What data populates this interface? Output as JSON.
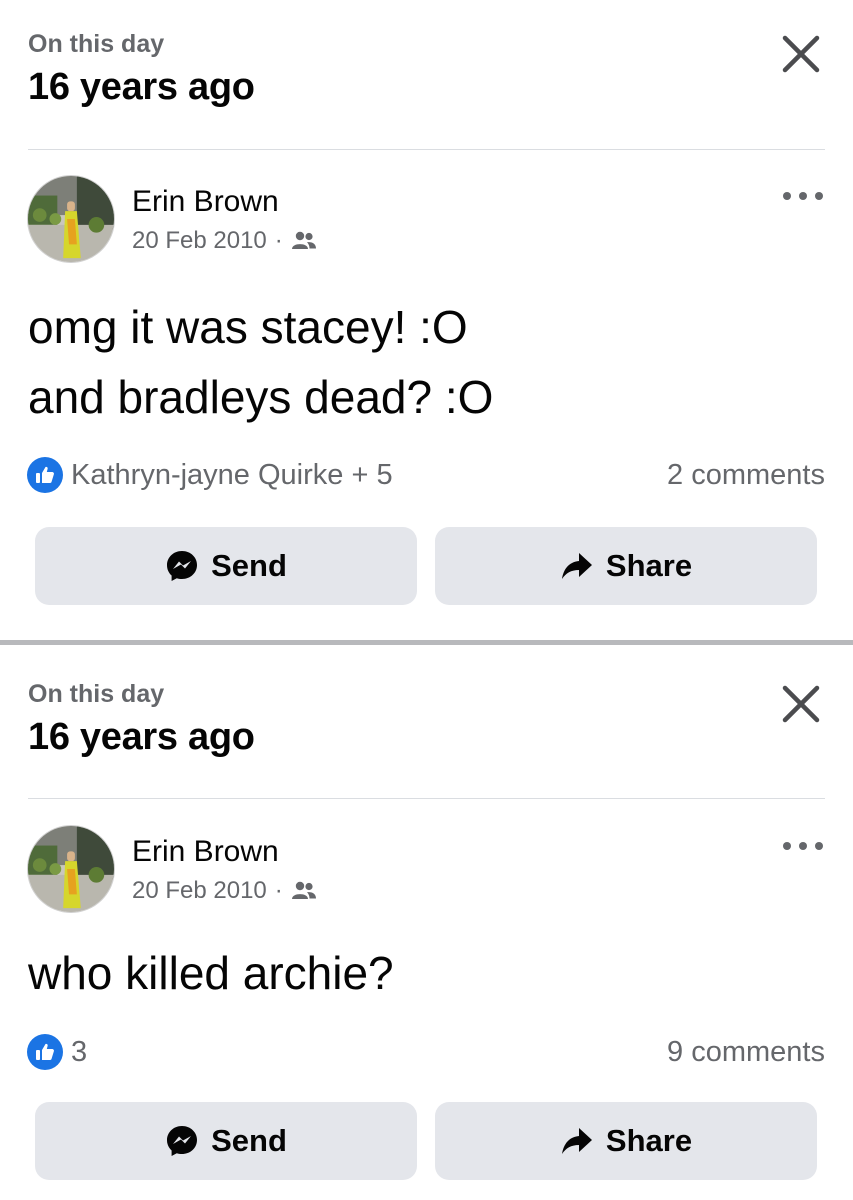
{
  "colors": {
    "like_blue": "#1b74e4",
    "secondary_text": "#65676b",
    "button_bg": "#e4e6eb",
    "divider": "#dadde1"
  },
  "posts": [
    {
      "header": {
        "subtitle": "On this day",
        "title": "16 years ago"
      },
      "author": "Erin Brown",
      "date": "20 Feb 2010",
      "meta_separator": "·",
      "audience_icon": "friends-icon",
      "text": "omg it was stacey! :O\nand bradleys dead? :O",
      "reactions_label": "Kathryn-jayne Quirke + 5",
      "comments_label": "2 comments",
      "send_label": "Send",
      "share_label": "Share"
    },
    {
      "header": {
        "subtitle": "On this day",
        "title": "16 years ago"
      },
      "author": "Erin Brown",
      "date": "20 Feb 2010",
      "meta_separator": "·",
      "audience_icon": "friends-icon",
      "text": "who killed archie?",
      "reactions_label": "3",
      "comments_label": "9 comments",
      "send_label": "Send",
      "share_label": "Share"
    }
  ]
}
